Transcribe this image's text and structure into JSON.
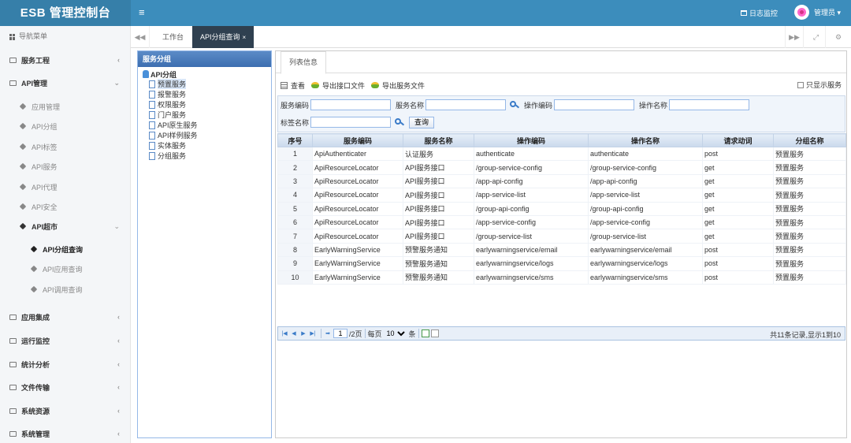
{
  "header": {
    "brand": "ESB 管理控制台",
    "menu_toggle": "≡",
    "log_monitor": "日志监控",
    "user": "管理员 ▾"
  },
  "sidebar": {
    "title": "导航菜单",
    "items": [
      {
        "label": "服务工程",
        "chevron": "‹"
      },
      {
        "label": "API管理",
        "chevron": "⌄"
      },
      {
        "label": "应用集成",
        "chevron": "‹"
      },
      {
        "label": "运行监控",
        "chevron": "‹"
      },
      {
        "label": "统计分析",
        "chevron": "‹"
      },
      {
        "label": "文件传输",
        "chevron": "‹"
      },
      {
        "label": "系统资源",
        "chevron": "‹"
      },
      {
        "label": "系统管理",
        "chevron": "‹"
      }
    ],
    "api_sub": [
      "应用管理",
      "API分组",
      "API标签",
      "API服务",
      "API代理",
      "API安全"
    ],
    "api_market": {
      "label": "API超市",
      "chevron": "⌄"
    },
    "market_sub": [
      "API分组查询",
      "API应用查询",
      "API调用查询"
    ]
  },
  "tabbar": {
    "nav_left": "◀◀",
    "tabs": [
      {
        "label": "工作台"
      },
      {
        "label": "API分组查询",
        "close": "×"
      }
    ],
    "nav_right": "▶▶",
    "expand": "⤢",
    "settings": "⚙"
  },
  "left_panel": {
    "title": "服务分组",
    "root": "API分组",
    "nodes": [
      "预置服务",
      "报警服务",
      "权限服务",
      "门户服务",
      "API原生服务",
      "API样例服务",
      "实体服务",
      "分组服务"
    ]
  },
  "content": {
    "tab": "列表信息",
    "toolbar": {
      "view": "查看",
      "export_interface": "导出接口文件",
      "export_service": "导出服务文件",
      "only_show_service": "只显示服务"
    },
    "search": {
      "service_code": "服务编码",
      "service_name": "服务名称",
      "operation_code": "操作编码",
      "operation_name": "操作名称",
      "tag_name": "标签名称",
      "query": "查询"
    },
    "columns": [
      "序号",
      "服务编码",
      "服务名称",
      "操作编码",
      "操作名称",
      "请求动词",
      "分组名称"
    ],
    "rows": [
      [
        "1",
        "ApiAuthenticater",
        "认证服务",
        "authenticate",
        "authenticate",
        "post",
        "预置服务"
      ],
      [
        "2",
        "ApiResourceLocator",
        "API服务接口",
        "/group-service-config",
        "/group-service-config",
        "get",
        "预置服务"
      ],
      [
        "3",
        "ApiResourceLocator",
        "API服务接口",
        "/app-api-config",
        "/app-api-config",
        "get",
        "预置服务"
      ],
      [
        "4",
        "ApiResourceLocator",
        "API服务接口",
        "/app-service-list",
        "/app-service-list",
        "get",
        "预置服务"
      ],
      [
        "5",
        "ApiResourceLocator",
        "API服务接口",
        "/group-api-config",
        "/group-api-config",
        "get",
        "预置服务"
      ],
      [
        "6",
        "ApiResourceLocator",
        "API服务接口",
        "/app-service-config",
        "/app-service-config",
        "get",
        "预置服务"
      ],
      [
        "7",
        "ApiResourceLocator",
        "API服务接口",
        "/group-service-list",
        "/group-service-list",
        "get",
        "预置服务"
      ],
      [
        "8",
        "EarlyWarningService",
        "预警服务通知",
        "earlywarningservice/email",
        "earlywarningservice/email",
        "post",
        "预置服务"
      ],
      [
        "9",
        "EarlyWarningService",
        "预警服务通知",
        "earlywarningservice/logs",
        "earlywarningservice/logs",
        "post",
        "预置服务"
      ],
      [
        "10",
        "EarlyWarningService",
        "预警服务通知",
        "earlywarningservice/sms",
        "earlywarningservice/sms",
        "post",
        "预置服务"
      ]
    ],
    "pager": {
      "page": "1",
      "total_pages": "/2页",
      "per_page_label": "每页",
      "per_page": "10",
      "unit": "条",
      "info": "共11条记录,显示1到10"
    }
  }
}
